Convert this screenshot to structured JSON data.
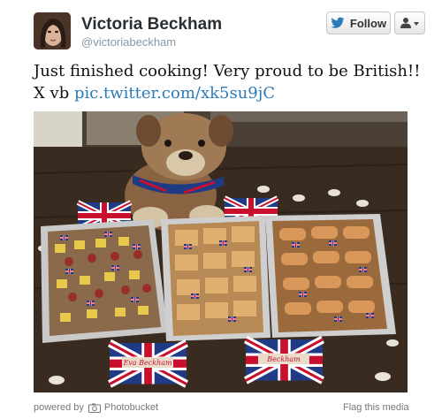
{
  "tweet": {
    "display_name": "Victoria Beckham",
    "username": "@victoriabeckham",
    "text": "Just finished cooking! Very proud to be British!! X vb ",
    "link_text": "pic.twitter.com/xk5su9jC"
  },
  "buttons": {
    "follow_label": "Follow",
    "user_menu_icon": "person-dropdown-icon"
  },
  "photo": {
    "card_left": "Eva Beckham",
    "card_right": "Beckham"
  },
  "footer": {
    "powered_by": "powered by",
    "provider": "Photobucket",
    "flag": "Flag this media"
  },
  "colors": {
    "link": "#2b7bb9",
    "username": "#8899a6",
    "flag_blue": "#1f3b86",
    "flag_red": "#c8102e"
  }
}
